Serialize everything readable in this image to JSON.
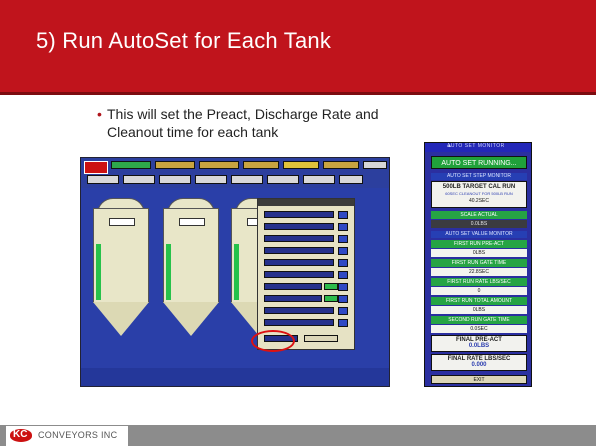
{
  "slide": {
    "title": "5) Run AutoSet for Each Tank",
    "bullet": "This will set the Preact, Discharge Rate and Cleanout time for each tank"
  },
  "monitor": {
    "header": "AUTO SET MONITOR",
    "running": "AUTO SET RUNNING...",
    "step_section": "AUTO SET STEP MONITOR",
    "target_title": "500LB TARGET CAL RUN",
    "target_sub": "60SEC CLEANOUT FOR 500LB RUN",
    "target_val": "40.2SEC",
    "scale_label": "SCALE ACTUAL",
    "scale_val": "0.0LBS",
    "value_section": "AUTO SET VALUE MONITOR",
    "rows": [
      {
        "label": "FIRST RUN PRE-ACT",
        "value": "0LBS"
      },
      {
        "label": "FIRST RUN GATE TIME",
        "value": "22.8SEC"
      },
      {
        "label": "FIRST RUN RATE LBS/SEC",
        "value": "0"
      },
      {
        "label": "FIRST RUN TOTAL AMOUNT",
        "value": "0LBS"
      },
      {
        "label": "SECOND RUN GATE TIME",
        "value": "0.0SEC"
      }
    ],
    "final_preact_label": "FINAL PRE-ACT",
    "final_preact_val": "0.0LBS",
    "final_rate_label": "FINAL RATE LBS/SEC",
    "final_rate_val": "0.000",
    "exit": "EXIT"
  },
  "footer": {
    "brand": "CONVEYORS INC",
    "logo": "KC"
  },
  "colors": {
    "title_bar": "#c0141c",
    "footer": "#8c8c8c",
    "hmi_blue": "#2a3fa8",
    "running_green": "#20a13a"
  }
}
